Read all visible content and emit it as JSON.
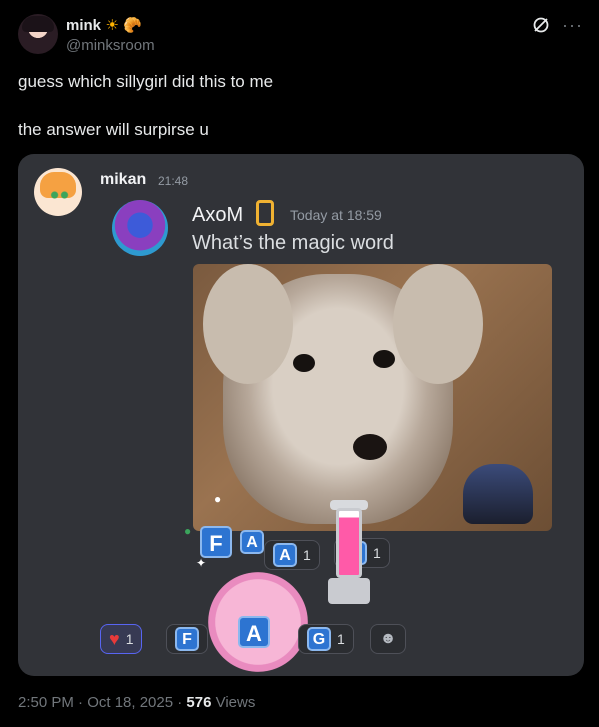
{
  "post": {
    "display_name": "mink",
    "name_emojis": [
      "☀",
      "🥐"
    ],
    "handle": "@minksroom",
    "text": "guess which sillygirl did this to me\n\nthe answer will surpirse u",
    "timestamp": "2:50 PM · Oct 18, 2025 · ",
    "views_count": "576",
    "views_label": " Views"
  },
  "embed": {
    "sender_name": "mikan",
    "sender_time": "21:48",
    "reply_name": "AxoM",
    "reply_time": "Today at 18:59",
    "reply_message": "What’s the magic word",
    "tiles_top": [
      {
        "letter": "F",
        "count": ""
      },
      {
        "letter": "A",
        "count": "1"
      },
      {
        "letter": "G",
        "count": "1"
      }
    ],
    "reactions": [
      {
        "icon": "heart-icon",
        "count": "1"
      },
      {
        "icon": "f-tile",
        "letter": "F",
        "count": ""
      },
      {
        "icon": "a-tile",
        "letter": "A",
        "count": ""
      },
      {
        "icon": "g-tile",
        "letter": "G",
        "count": "1"
      }
    ]
  },
  "colors": {
    "background": "#000000",
    "card": "#313338",
    "tile_blue": "#2d74d1",
    "heart": "#e83a3a",
    "phone_badge": "#f0b232"
  }
}
